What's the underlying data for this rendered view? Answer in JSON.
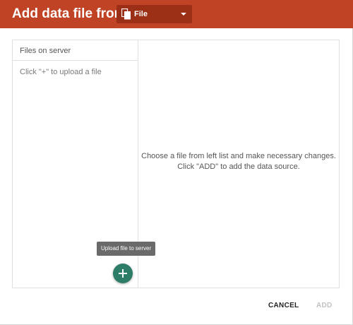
{
  "header": {
    "title": "Add data file from",
    "source_select": {
      "icon": "file-copy-icon",
      "selected": "File"
    },
    "color": "#bf4324"
  },
  "files_panel": {
    "header": "Files on server",
    "empty_hint": "Click \"+\" to upload a file",
    "upload_tooltip": "Upload file to server",
    "upload_button_icon": "plus-icon",
    "fab_color": "#2e7d68"
  },
  "detail_panel": {
    "instruction_line1": "Choose a file from left list and make necessary changes.",
    "instruction_line2": "Click \"ADD\" to add the data source."
  },
  "footer": {
    "cancel_label": "CANCEL",
    "add_label": "ADD",
    "add_enabled": false
  }
}
